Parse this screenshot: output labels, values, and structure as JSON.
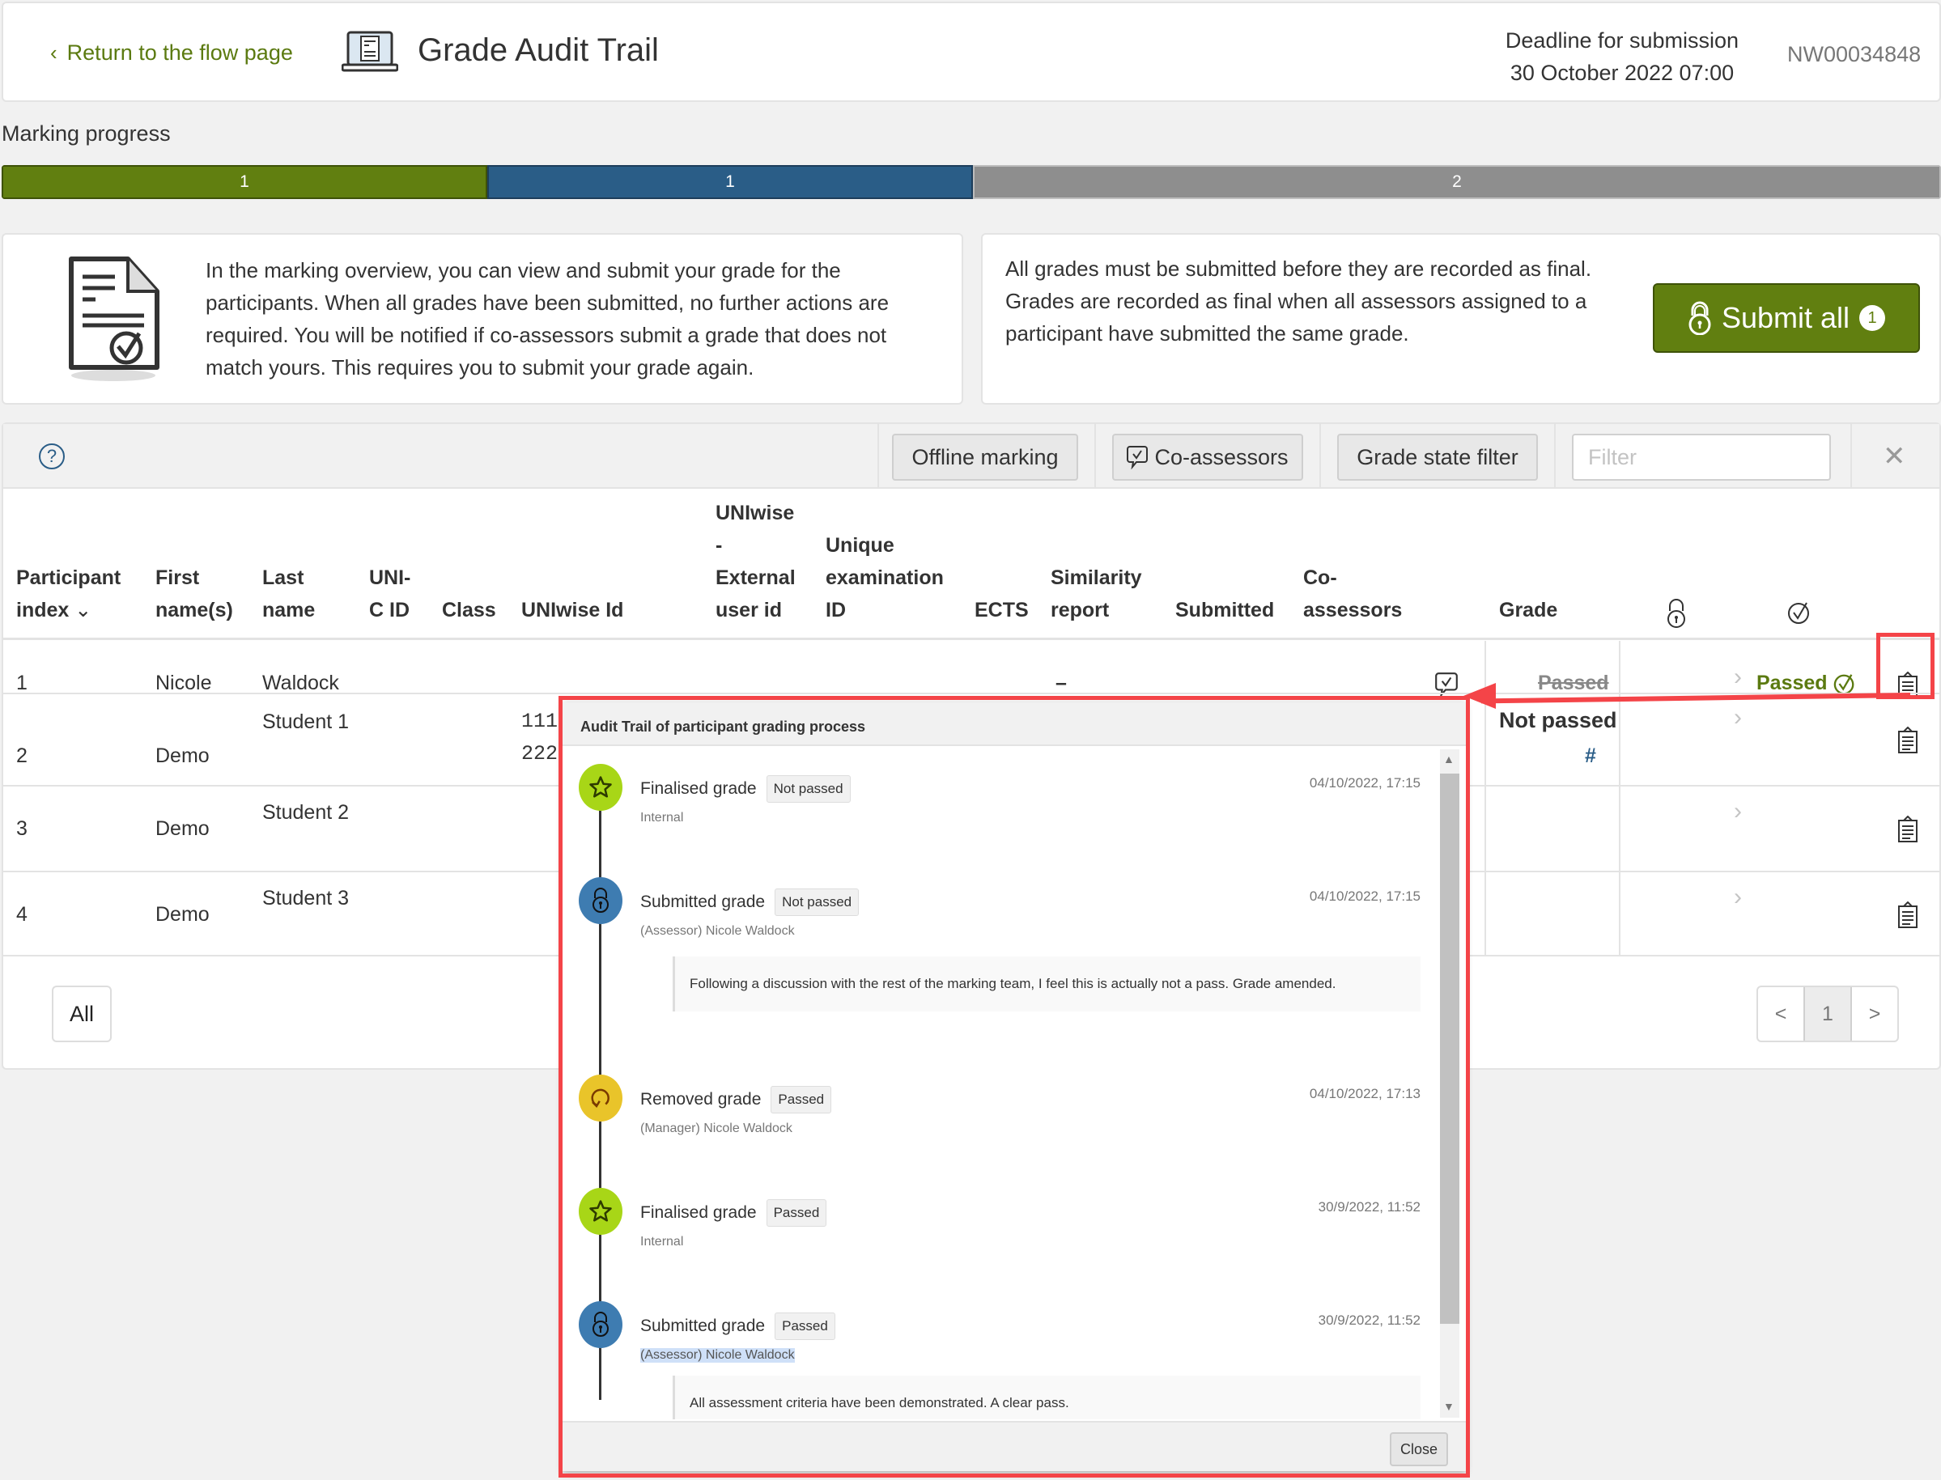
{
  "header": {
    "back_label": "Return to the flow page",
    "title": "Grade Audit Trail",
    "deadline_label": "Deadline for submission",
    "deadline_value": "30 October 2022 07:00",
    "code": "NW00034848"
  },
  "progress": {
    "label": "Marking progress",
    "segments": [
      {
        "value": "1",
        "color": "#617f10",
        "fraction": 0.25
      },
      {
        "value": "1",
        "color": "#2a5d87",
        "fraction": 0.25
      },
      {
        "value": "2",
        "color": "#8e8e8e",
        "fraction": 0.5
      }
    ]
  },
  "info": {
    "left_text": "In the marking overview, you can view and submit your grade for the participants. When all grades have been submitted, no further actions are required. You will be notified if co-assessors submit a grade that does not match yours. This requires you to submit your grade again.",
    "right_text": "All grades must be submitted before they are recorded as final. Grades are recorded as final when all assessors assigned to a participant have submitted the same grade.",
    "submit_all_label": "Submit all",
    "submit_all_count": "1"
  },
  "toolbar": {
    "help_icon": "?",
    "offline_marking": "Offline marking",
    "co_assessors": "Co-assessors",
    "grade_state_filter": "Grade state filter",
    "filter_placeholder": "Filter",
    "clear": "✕"
  },
  "table": {
    "headers": {
      "participant_index": "Participant index",
      "first_names": "First name(s)",
      "last_name": "Last name",
      "unic_id": "UNI-C ID",
      "class": "Class",
      "uniwise_id": "UNIwise Id",
      "external_user_id": "UNIwise - External user id",
      "unique_exam_id": "Unique examination ID",
      "ects": "ECTS",
      "similarity_report": "Similarity report",
      "submitted": "Submitted",
      "co_assessors": "Co-assessors",
      "grade": "Grade"
    },
    "rows": [
      {
        "index": "1",
        "first": "Nicole",
        "last": "Waldock",
        "uniwise_id": "",
        "similarity": "–",
        "grade": "Passed",
        "grade_struck": true,
        "final": "Passed"
      },
      {
        "index": "2",
        "first": "Demo",
        "last": "Student 1",
        "uniwise_id_l1": "111(",
        "uniwise_id_l2": "222(",
        "grade": "Not passed",
        "grade_extra": "#"
      },
      {
        "index": "3",
        "first": "Demo",
        "last": "Student 2"
      },
      {
        "index": "4",
        "first": "Demo",
        "last": "Student 3"
      }
    ]
  },
  "footer": {
    "all_label": "All",
    "prev": "<",
    "page": "1",
    "next": ">"
  },
  "modal": {
    "title": "Audit Trail of participant grading process",
    "close_label": "Close",
    "events": [
      {
        "type": "Finalised grade",
        "grade": "Not passed",
        "by": "Internal",
        "time": "04/10/2022, 17:15",
        "icon": "star-icon"
      },
      {
        "type": "Submitted grade",
        "grade": "Not passed",
        "by": "(Assessor) Nicole Waldock",
        "time": "04/10/2022, 17:15",
        "icon": "lock-icon",
        "comment": "Following a discussion with the rest of the marking team, I feel this is actually not a pass. Grade amended."
      },
      {
        "type": "Removed grade",
        "grade": "Passed",
        "by": "(Manager) Nicole Waldock",
        "time": "04/10/2022, 17:13",
        "icon": "undo-icon"
      },
      {
        "type": "Finalised grade",
        "grade": "Passed",
        "by": "Internal",
        "time": "30/9/2022, 11:52",
        "icon": "star-icon"
      },
      {
        "type": "Submitted grade",
        "grade": "Passed",
        "by": "(Assessor) Nicole Waldock",
        "time": "30/9/2022, 11:52",
        "icon": "lock-icon",
        "comment": "All assessment criteria have been demonstrated. A clear pass."
      }
    ]
  }
}
